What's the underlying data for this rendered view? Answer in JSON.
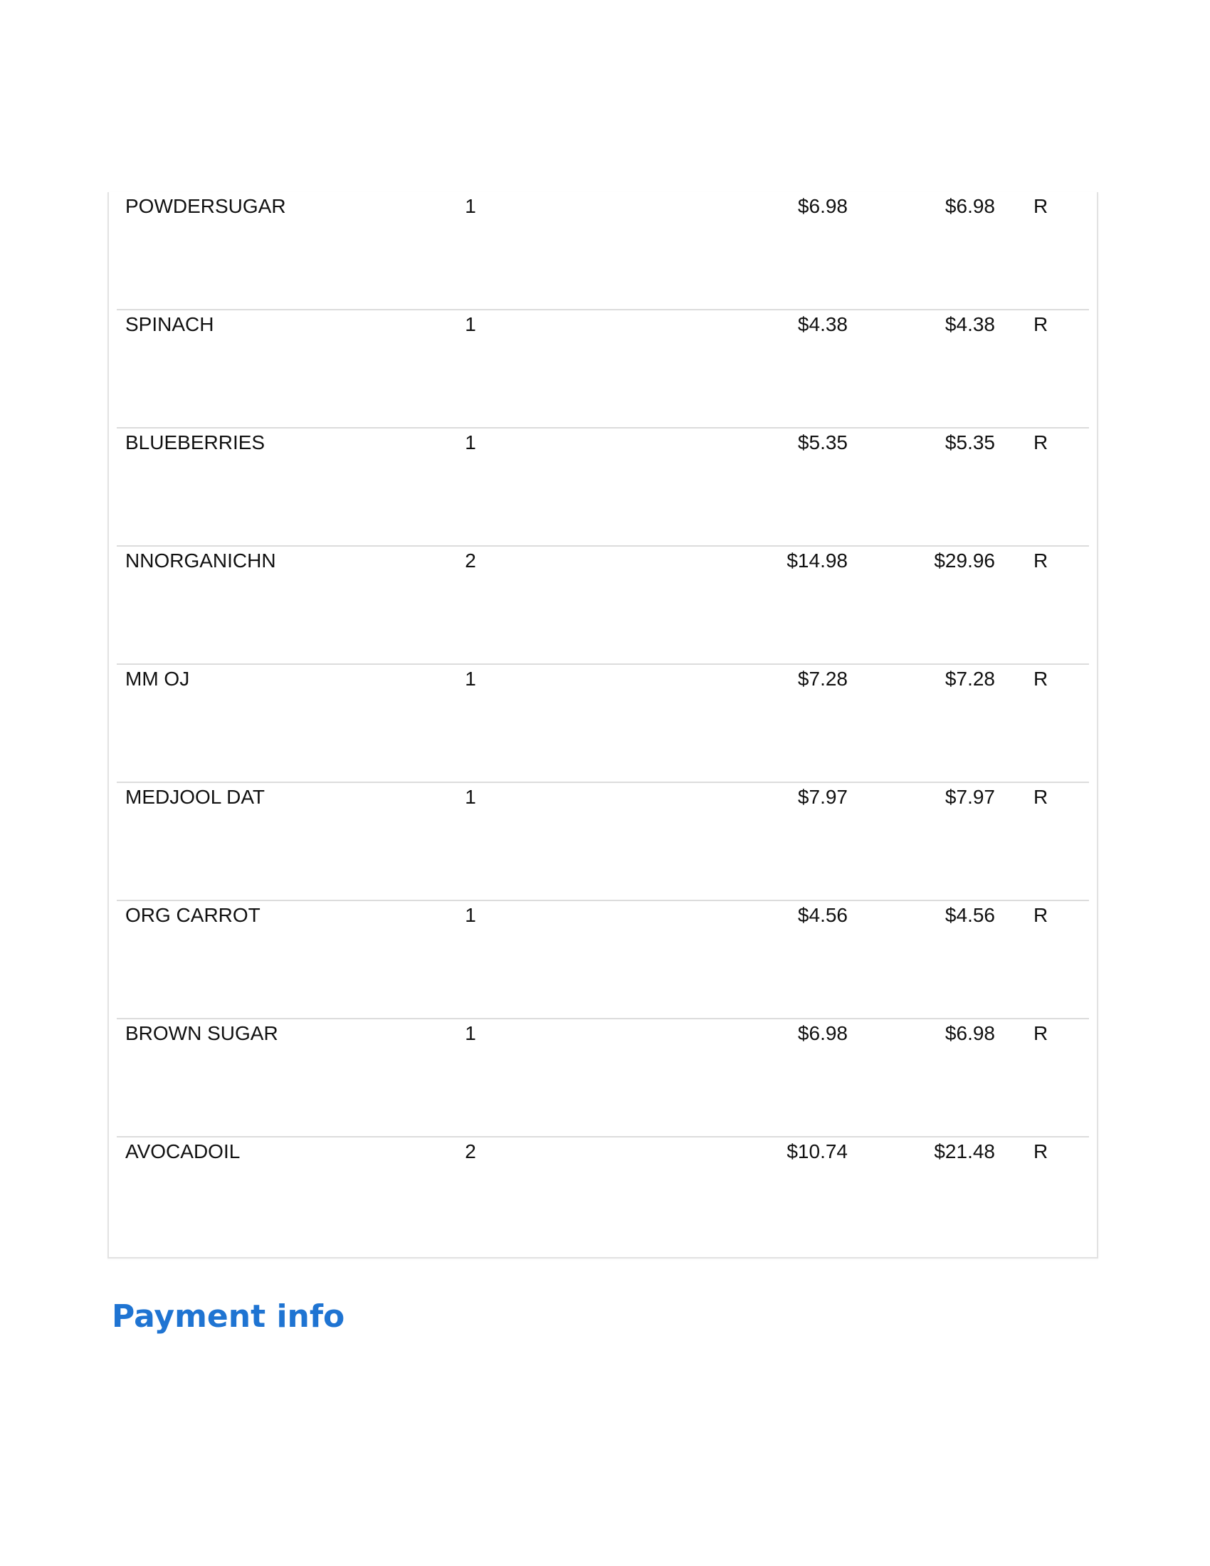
{
  "items": [
    {
      "name": "POWDERSUGAR",
      "qty": "1",
      "unit_price": "$6.98",
      "total": "$6.98",
      "flag": "R"
    },
    {
      "name": "SPINACH",
      "qty": "1",
      "unit_price": "$4.38",
      "total": "$4.38",
      "flag": "R"
    },
    {
      "name": "BLUEBERRIES",
      "qty": "1",
      "unit_price": "$5.35",
      "total": "$5.35",
      "flag": "R"
    },
    {
      "name": "NNORGANICHN",
      "qty": "2",
      "unit_price": "$14.98",
      "total": "$29.96",
      "flag": "R"
    },
    {
      "name": "MM OJ",
      "qty": "1",
      "unit_price": "$7.28",
      "total": "$7.28",
      "flag": "R"
    },
    {
      "name": "MEDJOOL DAT",
      "qty": "1",
      "unit_price": "$7.97",
      "total": "$7.97",
      "flag": "R"
    },
    {
      "name": "ORG CARROT",
      "qty": "1",
      "unit_price": "$4.56",
      "total": "$4.56",
      "flag": "R"
    },
    {
      "name": "BROWN SUGAR",
      "qty": "1",
      "unit_price": "$6.98",
      "total": "$6.98",
      "flag": "R"
    },
    {
      "name": "AVOCADOIL",
      "qty": "2",
      "unit_price": "$10.74",
      "total": "$21.48",
      "flag": "R"
    }
  ],
  "payment": {
    "heading": "Payment info"
  },
  "colors": {
    "heading_blue": "#1f74d2",
    "divider": "#dcdcdc"
  }
}
